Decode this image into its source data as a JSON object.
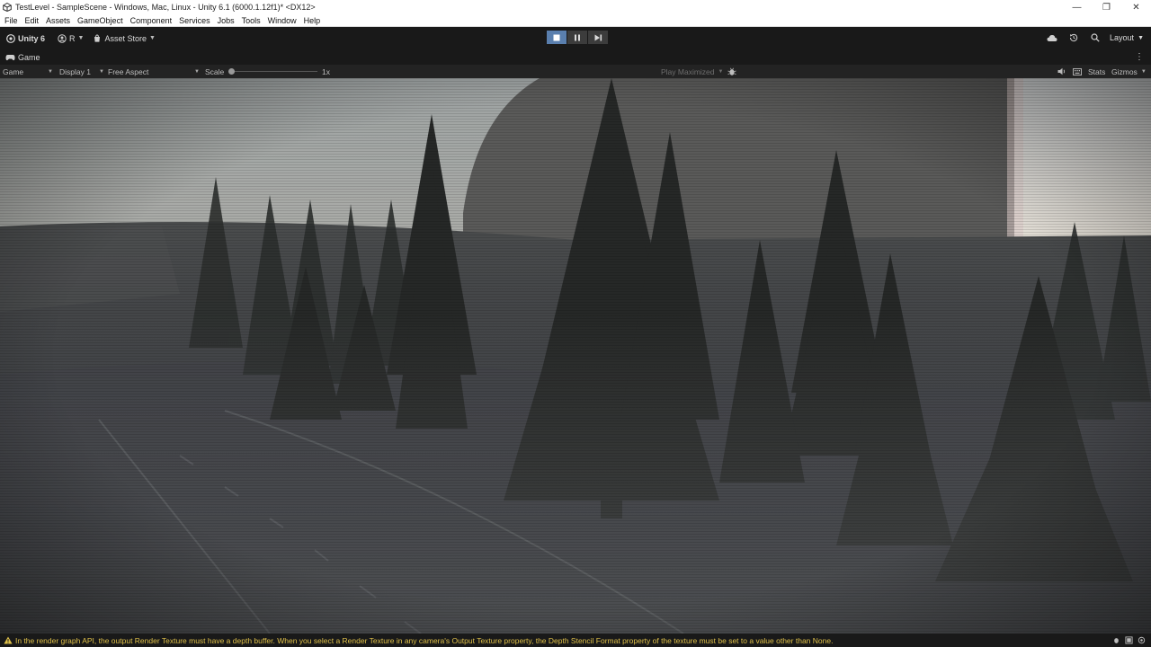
{
  "window": {
    "title": "TestLevel - SampleScene - Windows, Mac, Linux - Unity 6.1 (6000.1.12f1)* <DX12>"
  },
  "menu": [
    "File",
    "Edit",
    "Assets",
    "GameObject",
    "Component",
    "Services",
    "Jobs",
    "Tools",
    "Window",
    "Help"
  ],
  "toolbar": {
    "unity_label": "Unity 6",
    "account_label": "R",
    "asset_store_label": "Asset Store",
    "layout_label": "Layout"
  },
  "tab": {
    "game_label": "Game"
  },
  "game_toolbar": {
    "mode_label": "Game",
    "display_label": "Display 1",
    "aspect_label": "Free Aspect",
    "scale_label": "Scale",
    "scale_value": "1x",
    "play_mode_label": "Play Maximized",
    "stats_label": "Stats",
    "gizmos_label": "Gizmos"
  },
  "status": {
    "message": "In the render graph API, the output Render Texture must have a depth buffer. When you select a Render Texture in any camera's Output Texture property, the Depth Stencil Format property of the texture must be set to a value other than None.",
    "warning_color": "#e0c14a"
  },
  "icons": {
    "title": "unity-logo-icon",
    "cloud": "cloud-icon",
    "history": "history-icon",
    "search": "search-icon",
    "stop": "stop-icon",
    "pause": "pause-icon",
    "step": "step-icon"
  }
}
